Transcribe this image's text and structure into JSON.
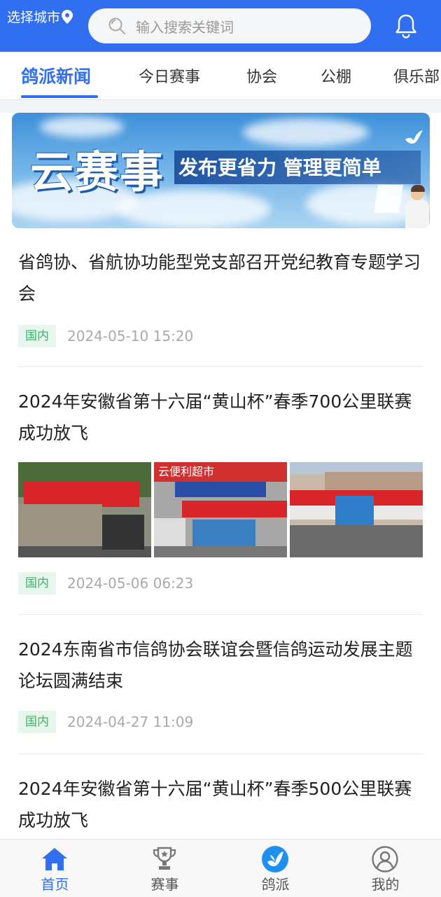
{
  "header": {
    "city_label": "选择城市",
    "search_placeholder": "输入搜索关键词",
    "accent": "#2f6ff0"
  },
  "tabs": [
    {
      "label": "鸽派新闻",
      "active": true
    },
    {
      "label": "今日赛事"
    },
    {
      "label": "协会"
    },
    {
      "label": "公棚"
    },
    {
      "label": "俱乐部"
    }
  ],
  "banner": {
    "title": "云赛事",
    "subtitle": "发布更省力 管理更简单"
  },
  "news": [
    {
      "title": "省鸽协、省航协功能型党支部召开党纪教育专题学习会",
      "tag": "国内",
      "date": "2024-05-10 15:20"
    },
    {
      "title": "2024年安徽省第十六届“黄山杯”春季700公里联赛成功放飞",
      "tag": "国内",
      "date": "2024-05-06 06:23",
      "images": [
        "photo-trucks-red-banner",
        "photo-convenience-store-tent",
        "photo-truck-two-people"
      ]
    },
    {
      "title": "2024东南省市信鸽协会联谊会暨信鸽运动发展主题论坛圆满结束",
      "tag": "国内",
      "date": "2024-04-27 11:09"
    },
    {
      "title": "2024年安徽省第十六届“黄山杯”春季500公里联赛成功放飞"
    }
  ],
  "thumb_texts": {
    "photo2_sign": "云便利超市"
  },
  "bottom_nav": [
    {
      "label": "首页",
      "icon": "home-icon",
      "active": true
    },
    {
      "label": "赛事",
      "icon": "trophy-icon"
    },
    {
      "label": "鸽派",
      "icon": "pigeon-icon"
    },
    {
      "label": "我的",
      "icon": "user-icon"
    }
  ]
}
